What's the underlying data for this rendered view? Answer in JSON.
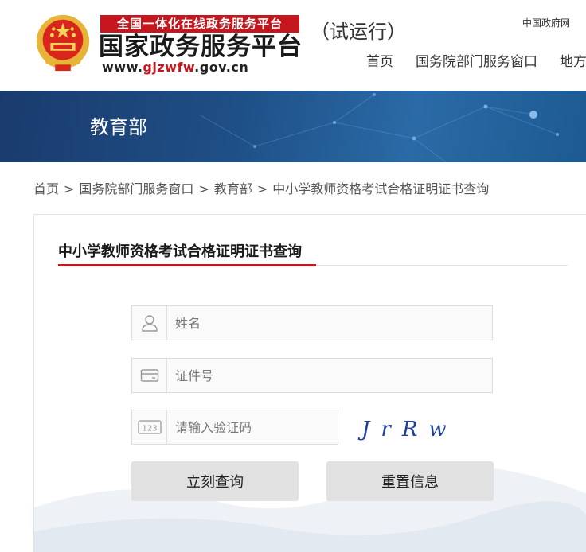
{
  "header": {
    "slogan": "全国一体化在线政务服务平台",
    "site_title": "国家政务服务平台",
    "url_prefix": "www.",
    "url_highlight": "gjzwfw",
    "url_suffix": ".gov.cn",
    "trial_label": "（试运行）",
    "gov_link": "中国政府网",
    "nav": [
      "首页",
      "国务院部门服务窗口",
      "地方"
    ]
  },
  "banner": {
    "title": "教育部"
  },
  "breadcrumb": {
    "items": [
      "首页",
      "国务院部门服务窗口",
      "教育部",
      "中小学教师资格考试合格证明证书查询"
    ],
    "separator": ">"
  },
  "form": {
    "title": "中小学教师资格考试合格证明证书查询",
    "name_placeholder": "姓名",
    "id_placeholder": "证件号",
    "captcha_placeholder": "请输入验证码",
    "captcha_text": "JrRw",
    "query_button": "立刻查询",
    "reset_button": "重置信息"
  },
  "colors": {
    "brand_red": "#c4161c",
    "banner_blue": "#1e4f86",
    "button_gray": "#e1e1e1",
    "captcha_blue": "#1f3f9e"
  },
  "icons": [
    "national-emblem-icon",
    "user-icon",
    "id-card-icon",
    "captcha-123-icon"
  ]
}
